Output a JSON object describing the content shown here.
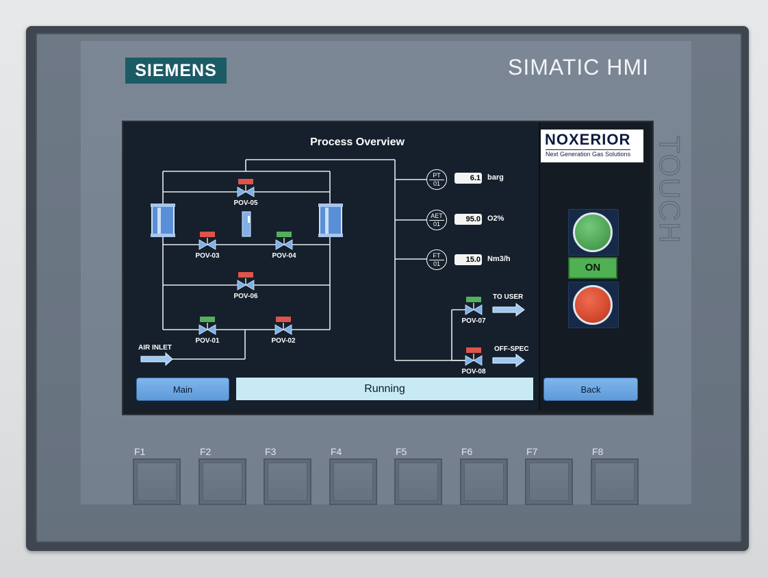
{
  "device": {
    "brand": "SIEMENS",
    "model": "SIMATIC HMI",
    "touch_label": "TOUCH"
  },
  "screen": {
    "title": "Process Overview",
    "logo": {
      "name": "NOXERIOR",
      "tagline": "Next Generation Gas Solutions"
    },
    "instruments": [
      {
        "tag": "PT",
        "num": "01",
        "value": "6.1",
        "unit": "barg"
      },
      {
        "tag": "AET",
        "num": "01",
        "value": "95.0",
        "unit": "O2%"
      },
      {
        "tag": "FT",
        "num": "01",
        "value": "15.0",
        "unit": "Nm3/h"
      }
    ],
    "valves": [
      {
        "label": "POV-05",
        "state": "closed"
      },
      {
        "label": "POV-03",
        "state": "closed"
      },
      {
        "label": "POV-04",
        "state": "open"
      },
      {
        "label": "POV-06",
        "state": "closed"
      },
      {
        "label": "POV-01",
        "state": "open"
      },
      {
        "label": "POV-02",
        "state": "closed"
      },
      {
        "label": "POV-07",
        "state": "open"
      },
      {
        "label": "POV-08",
        "state": "closed"
      }
    ],
    "flow_labels": {
      "inlet": "AIR INLET",
      "to_user": "TO USER",
      "off_spec": "OFF-SPEC"
    },
    "buttons": {
      "main": "Main",
      "back": "Back",
      "on_indicator": "ON"
    },
    "status": "Running",
    "colors": {
      "open": "#55b05a",
      "closed": "#e0534a",
      "background": "#15202c",
      "button": "#6fa8e4"
    }
  },
  "function_keys": [
    "F1",
    "F2",
    "F3",
    "F4",
    "F5",
    "F6",
    "F7",
    "F8"
  ]
}
